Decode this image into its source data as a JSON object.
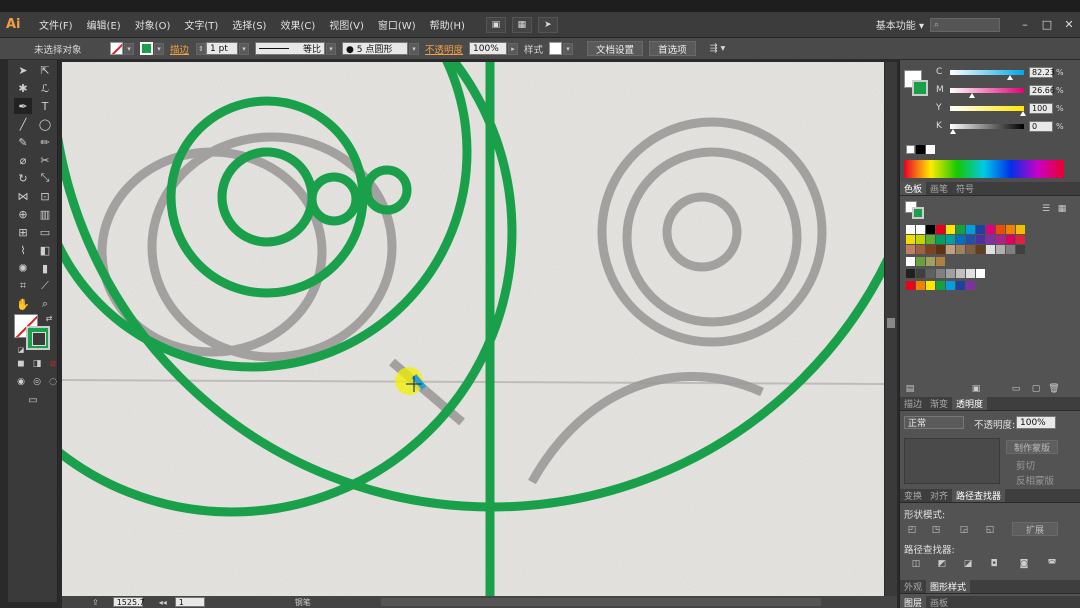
{
  "app": {
    "logo": "Ai",
    "workspace": "基本功能 ▾",
    "search_placeholder": "⌕"
  },
  "menu": [
    "文件(F)",
    "编辑(E)",
    "对象(O)",
    "文字(T)",
    "选择(S)",
    "效果(C)",
    "视图(V)",
    "窗口(W)",
    "帮助(H)"
  ],
  "control": {
    "selection": "未选择对象",
    "stroke_label": "描边",
    "stroke_weight": "1 pt",
    "profile": "等比",
    "brush": "● 5 点圆形",
    "opacity_label": "不透明度",
    "opacity_value": "100%",
    "style_label": "样式",
    "doc_setup": "文档设置",
    "prefs": "首选项"
  },
  "status": {
    "zoom": "1525.7",
    "page": "1",
    "tool": "钢笔"
  },
  "color_panel": {
    "channels": [
      {
        "label": "C",
        "value": "82.23",
        "gradient": "linear-gradient(90deg,#fff,#00a8e8)"
      },
      {
        "label": "M",
        "value": "26.66",
        "gradient": "linear-gradient(90deg,#fff,#e0007a)"
      },
      {
        "label": "Y",
        "value": "100",
        "gradient": "linear-gradient(90deg,#fff,#ffe600)"
      },
      {
        "label": "K",
        "value": "0",
        "gradient": "linear-gradient(90deg,#fff,#000)"
      }
    ],
    "unit": "%"
  },
  "swatch_tabs": [
    "色板",
    "画笔",
    "符号"
  ],
  "transparency_tabs": [
    "描边",
    "渐变",
    "透明度"
  ],
  "transparency": {
    "mode": "正常",
    "opacity_label": "不透明度:",
    "opacity": "100%",
    "make_mask": "制作蒙版",
    "clip": "剪切",
    "invert": "反相蒙版"
  },
  "pathfinder_tabs": [
    "变换",
    "对齐",
    "路径查找器"
  ],
  "pathfinder": {
    "shape_modes": "形状模式:",
    "expand": "扩展",
    "pathfinders": "路径查找器:"
  },
  "bottom_tabs": [
    "外观",
    "图形样式"
  ],
  "bottom_tabs2": [
    "图层",
    "画板"
  ],
  "colors": {
    "stroke": "#1aa04a",
    "accent": "#f0a040"
  }
}
